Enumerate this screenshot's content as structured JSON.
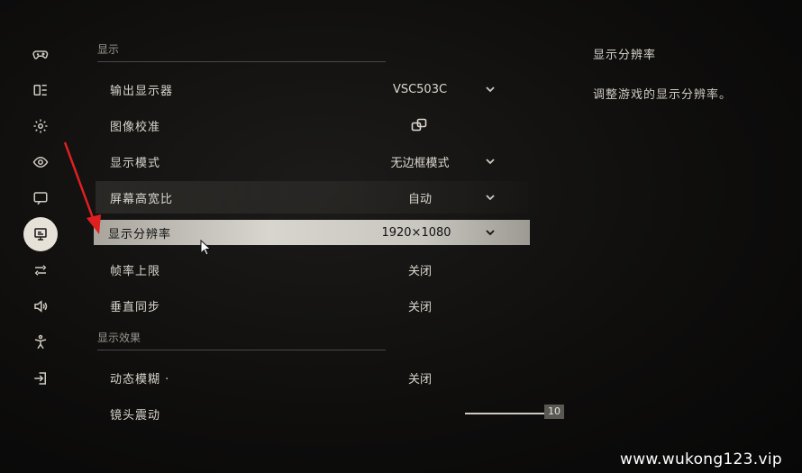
{
  "sections": {
    "display": "显示",
    "display_effects": "显示效果"
  },
  "rows": {
    "output_display": {
      "label": "输出显示器",
      "value": "VSC503C"
    },
    "calibration": {
      "label": "图像校准"
    },
    "display_mode": {
      "label": "显示模式",
      "value": "无边框模式"
    },
    "aspect_ratio": {
      "label": "屏幕高宽比",
      "value": "自动"
    },
    "resolution": {
      "label": "显示分辨率",
      "value": "1920×1080"
    },
    "fps_limit": {
      "label": "帧率上限",
      "value": "关闭"
    },
    "vsync": {
      "label": "垂直同步",
      "value": "关闭"
    },
    "motion_blur": {
      "label": "动态模糊 ·",
      "value": "关闭"
    },
    "camera_shake": {
      "label": "镜头震动",
      "value": "10",
      "fraction": 1.0
    }
  },
  "description": {
    "title": "显示分辨率",
    "text": "调整游戏的显示分辨率。"
  },
  "rail_icons": [
    "gamepad-icon",
    "key-binding-icon",
    "gear-icon",
    "eye-icon",
    "chat-icon",
    "monitor-icon",
    "sliders-icon",
    "speaker-icon",
    "accessibility-icon",
    "exit-icon"
  ],
  "watermark": "www.wukong123.vip",
  "colors": {
    "highlight": "#d8d5cf",
    "arrow": "#e02020"
  }
}
